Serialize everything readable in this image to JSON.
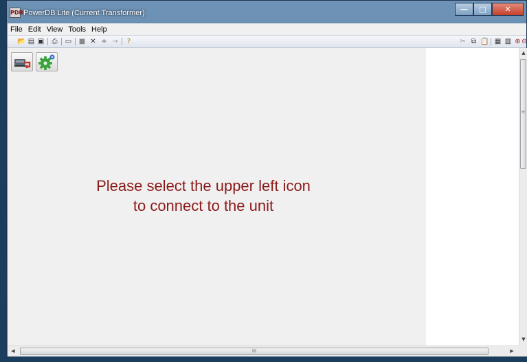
{
  "window": {
    "title": "PowerDB Lite (Current Transformer)",
    "app_icon_text": "PDB"
  },
  "menu": [
    "File",
    "Edit",
    "View",
    "Tools",
    "Help"
  ],
  "toolbar": {
    "left": [
      {
        "icon": "open-folder-icon",
        "glyph": "📂"
      },
      {
        "icon": "new-document-icon",
        "glyph": "▤"
      },
      {
        "icon": "save-icon",
        "glyph": "▣"
      },
      {
        "icon": "print-icon",
        "glyph": "⎙"
      },
      {
        "icon": "form-icon",
        "glyph": "▭"
      },
      {
        "icon": "block-icon",
        "glyph": "■"
      },
      {
        "icon": "delete-icon",
        "glyph": "✕"
      },
      {
        "icon": "divide-icon",
        "glyph": "÷"
      },
      {
        "icon": "arrow-right-icon",
        "glyph": "→"
      },
      {
        "icon": "help-key-icon",
        "glyph": "?"
      }
    ],
    "right": [
      {
        "icon": "cut-icon",
        "glyph": "✂"
      },
      {
        "icon": "copy-icon",
        "glyph": "⧉"
      },
      {
        "icon": "paste-icon",
        "glyph": "📋"
      },
      {
        "icon": "table-icon",
        "glyph": "▦"
      },
      {
        "icon": "report-icon",
        "glyph": "▥"
      },
      {
        "icon": "zoom-in-icon",
        "glyph": "⊕"
      },
      {
        "icon": "zoom-out-icon",
        "glyph": "⊖"
      }
    ]
  },
  "pane": {
    "message_line1": "Please select the upper left icon",
    "message_line2": "to connect to the unit",
    "message_color": "#8b1a1a"
  },
  "scrollbar": {
    "h_grip": "III",
    "v_grip": "≡"
  }
}
